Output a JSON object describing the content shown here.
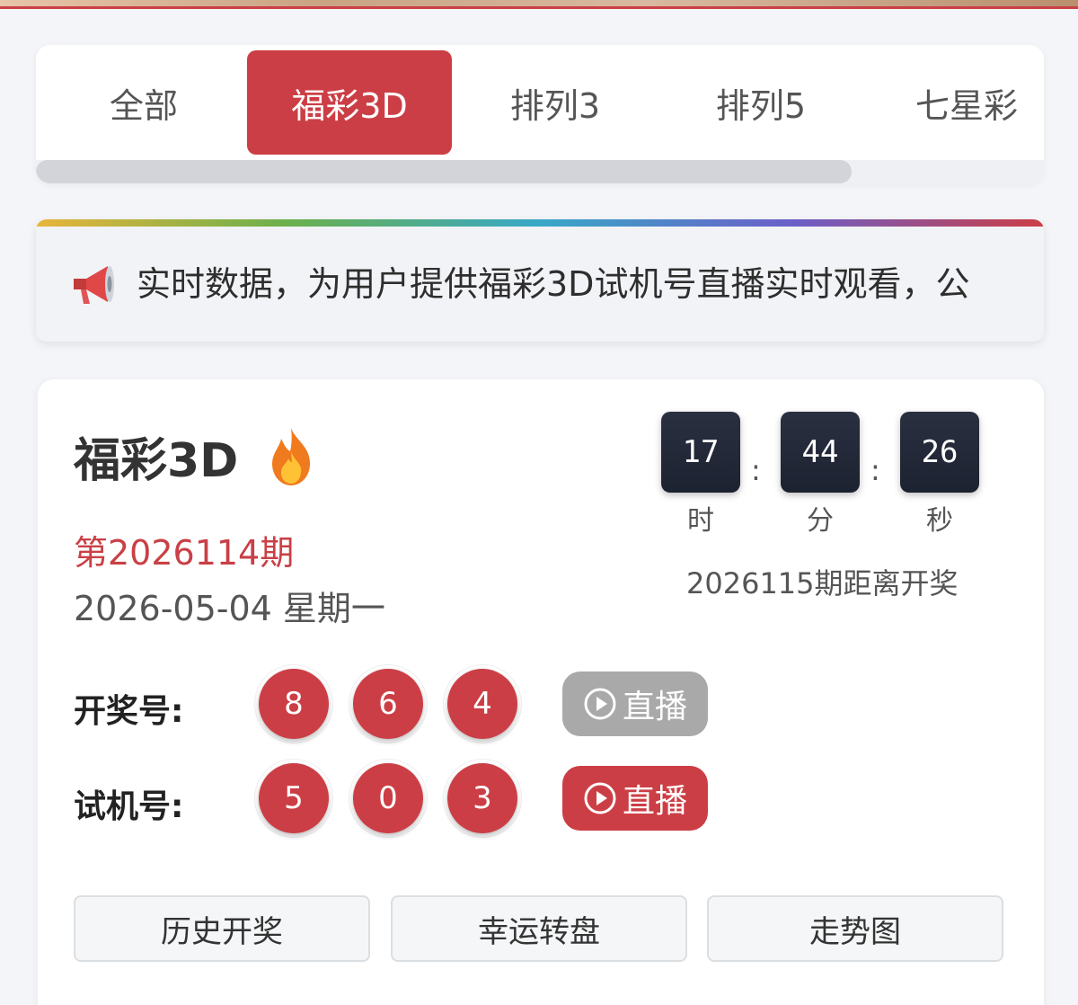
{
  "tabs": [
    {
      "label": "全部",
      "active": false
    },
    {
      "label": "福彩3D",
      "active": true
    },
    {
      "label": "排列3",
      "active": false
    },
    {
      "label": "排列5",
      "active": false
    },
    {
      "label": "七星彩",
      "active": false
    }
  ],
  "notice": {
    "icon": "megaphone-icon",
    "text": "实时数据，为用户提供福彩3D试机号直播实时观看，公"
  },
  "lottery": {
    "title": "福彩3D",
    "title_icon": "fire-icon",
    "issue": "第2026114期",
    "date": "2026-05-04 星期一"
  },
  "countdown": {
    "hours": "17",
    "minutes": "44",
    "seconds": "26",
    "separator": ":",
    "hours_label": "时",
    "minutes_label": "分",
    "seconds_label": "秒",
    "caption": "2026115期距离开奖"
  },
  "draw": {
    "label": "开奖号:",
    "numbers": [
      "8",
      "6",
      "4"
    ],
    "live_label": "直播"
  },
  "trial": {
    "label": "试机号:",
    "numbers": [
      "5",
      "0",
      "3"
    ],
    "live_label": "直播"
  },
  "actions": {
    "history": "历史开奖",
    "wheel": "幸运转盘",
    "trend": "走势图"
  },
  "colors": {
    "accent": "#cc3e45",
    "disabled": "#a9a9a9",
    "timer_bg": "#1c2230"
  }
}
